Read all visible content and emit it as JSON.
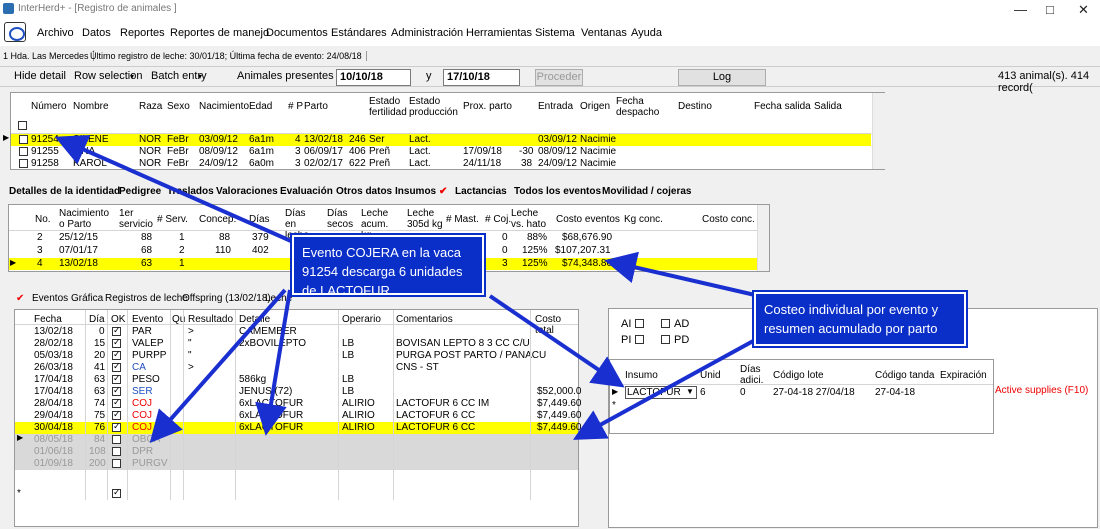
{
  "window": {
    "title": "InterHerd+ - [Registro de animales ]",
    "min": "—",
    "max": "□",
    "close": "✕"
  },
  "menu": [
    "Archivo",
    "Datos",
    "Reportes",
    "Reportes de manejo",
    "Documentos",
    "Estándares",
    "Administración",
    "Herramientas",
    "Sistema",
    "Ventanas",
    "Ayuda"
  ],
  "status": {
    "farm": "1 Hda. Las Mercedes",
    "info": "Último registro de leche: 30/01/18; Última fecha de evento: 24/08/18"
  },
  "toolbar": {
    "hide": "Hide detail",
    "rowsel": "Row selection",
    "batch": "Batch entry",
    "present": "Animales presentes entre",
    "from": "10/10/18",
    "y": "y",
    "to": "17/10/18",
    "proceed": "Proceder",
    "log": "Log",
    "count": "413 animal(s). 414 record("
  },
  "animal_grid": {
    "headers": [
      "Número",
      "Nombre",
      "Raza",
      "Sexo",
      "Nacimiento",
      "Edad",
      "# P",
      "Parto",
      "Estado fertilidad",
      "Estado producción",
      "Prox. parto",
      "Entrada",
      "Origen",
      "Fecha despacho",
      "Destino",
      "Fecha salida",
      "Salida"
    ],
    "rows": [
      {
        "num": "91254",
        "name": "SILENE",
        "raza": "NOR",
        "sexo": "FeBr",
        "nac": "03/09/12",
        "edad": "6a1m",
        "p": "4",
        "parto": "13/02/18",
        "d": "246",
        "fert": "Ser",
        "prod": "Lact.",
        "prox": "",
        "x": "",
        "entrada": "03/09/12",
        "origen": "Nacimie"
      },
      {
        "num": "91255",
        "name": "LINA",
        "raza": "NOR",
        "sexo": "FeBr",
        "nac": "08/09/12",
        "edad": "6a1m",
        "p": "3",
        "parto": "06/09/17",
        "d": "406",
        "fert": "Preñ",
        "prod": "Lact.",
        "prox": "17/09/18",
        "x": "-30",
        "entrada": "08/09/12",
        "origen": "Nacimie"
      },
      {
        "num": "91258",
        "name": "KAROL",
        "raza": "NOR",
        "sexo": "FeBr",
        "nac": "24/09/12",
        "edad": "6a0m",
        "p": "3",
        "parto": "02/02/17",
        "d": "622",
        "fert": "Preñ",
        "prod": "Lact.",
        "prox": "24/11/18",
        "x": "38",
        "entrada": "24/09/12",
        "origen": "Nacimie"
      }
    ]
  },
  "detail_tabs": [
    "Detalles de la identidad",
    "Pedigree",
    "Traslados",
    "Valoraciones",
    "Evaluación",
    "Otros datos",
    "Insumos",
    "Lactancias",
    "Todos los eventos",
    "Movilidad / cojeras"
  ],
  "lact_grid": {
    "headers": [
      "No.",
      "Nacimiento o Parto",
      "1er servicio",
      "# Serv.",
      "Concep.",
      "Días",
      "Días en leche",
      "Días secos",
      "Leche acum. kg",
      "Leche 305d kg",
      "# Mast.",
      "# Coj.",
      "Leche vs. hato",
      "Costo eventos",
      "Kg conc.",
      "Costo conc."
    ],
    "rows": [
      {
        "no": "2",
        "fecha": "25/12/15",
        "s1": "88",
        "serv": "1",
        "conc": "88",
        "dias": "379",
        "coj": "0",
        "vs": "88%",
        "costo": "$68,676.90"
      },
      {
        "no": "3",
        "fecha": "07/01/17",
        "s1": "68",
        "serv": "2",
        "conc": "110",
        "dias": "402",
        "coj": "0",
        "vs": "125%",
        "costo": "$107,207.31"
      },
      {
        "no": "4",
        "fecha": "13/02/18",
        "s1": "63",
        "serv": "1",
        "conc": "",
        "dias": "",
        "coj": "3",
        "vs": "125%",
        "costo": "$74,348.80"
      }
    ]
  },
  "event_tabs": [
    "Eventos",
    "Gráfica",
    "Registros de leche",
    "Offspring (13/02/18)",
    "Leche"
  ],
  "events_grid": {
    "headers": [
      "Fecha",
      "Día",
      "OK",
      "Evento",
      "Qu",
      "Resultado",
      "Detalle",
      "Operario",
      "Comentarios",
      "Costo total"
    ],
    "rows": [
      {
        "f": "13/02/18",
        "d": "0",
        "ev": "PAR",
        "res": ">",
        "det": "CAMEMBER",
        "op": "",
        "com": "",
        "cost": "",
        "cls": ""
      },
      {
        "f": "28/02/18",
        "d": "15",
        "ev": "VALEP",
        "res": "\"",
        "det": "2xBOVILEPTO",
        "op": "LB",
        "com": "BOVISAN LEPTO 8 3 CC C/U",
        "cost": "",
        "cls": ""
      },
      {
        "f": "05/03/18",
        "d": "20",
        "ev": "PURPP",
        "res": "\"",
        "det": "",
        "op": "LB",
        "com": "PURGA POST PARTO / PANACU",
        "cost": "",
        "cls": ""
      },
      {
        "f": "26/03/18",
        "d": "41",
        "ev": "CA",
        "res": ">",
        "det": "",
        "op": "",
        "com": "CNS - ST",
        "cost": "",
        "cls": "blue"
      },
      {
        "f": "17/04/18",
        "d": "63",
        "ev": "PESO",
        "res": "",
        "det": "586kg",
        "op": "LB",
        "com": "",
        "cost": "",
        "cls": ""
      },
      {
        "f": "17/04/18",
        "d": "63",
        "ev": "SER",
        "res": "",
        "det": "JENUS (72)",
        "op": "LB",
        "com": "",
        "cost": "$52,000.0",
        "cls": "blue"
      },
      {
        "f": "28/04/18",
        "d": "74",
        "ev": "COJ",
        "res": "",
        "det": "6xLACTOFUR",
        "op": "ALIRIO",
        "com": "LACTOFUR 6 CC IM",
        "cost": "$7,449.60",
        "cls": "red"
      },
      {
        "f": "29/04/18",
        "d": "75",
        "ev": "COJ",
        "res": "",
        "det": "6xLACTOFUR",
        "op": "ALIRIO",
        "com": "LACTOFUR 6 CC",
        "cost": "$7,449.60",
        "cls": "red"
      },
      {
        "f": "30/04/18",
        "d": "76",
        "ev": "COJ",
        "res": "",
        "det": "6xLACTOFUR",
        "op": "ALIRIO",
        "com": "LACTOFUR 6 CC",
        "cost": "$7,449.60",
        "cls": "red"
      },
      {
        "f": "08/05/18",
        "d": "84",
        "ev": "OBCA",
        "res": "",
        "det": "",
        "op": "",
        "com": "",
        "cost": "",
        "cls": "grey"
      },
      {
        "f": "01/06/18",
        "d": "108",
        "ev": "DPR",
        "res": "",
        "det": "",
        "op": "",
        "com": "",
        "cost": "",
        "cls": "grey"
      },
      {
        "f": "01/09/18",
        "d": "200",
        "ev": "PURGV",
        "res": "",
        "det": "",
        "op": "",
        "com": "",
        "cost": "",
        "cls": "grey"
      }
    ]
  },
  "filters": {
    "ai": "AI",
    "ad": "AD",
    "pi": "PI",
    "pd": "PD"
  },
  "supply_grid": {
    "headers": [
      "Insumo",
      "Unid",
      "Días adici.",
      "Código lote",
      "Código tanda",
      "Expiración"
    ],
    "row": {
      "insumo": "LACTOFUR",
      "unid": "6",
      "dias": "0",
      "lote": "27-04-18 27/04/18",
      "tanda": "27-04-18",
      "exp": ""
    },
    "active": "Active supplies (F10)"
  },
  "callouts": {
    "c1": "Evento COJERA en la vaca 91254 descarga 6 unidades de LACTOFUR",
    "c2": "Costeo individual por evento y resumen acumulado por parto"
  },
  "colors": {
    "highlight": "#ffff00",
    "callout": "#0a2fc9",
    "arrow": "#1a2fd0"
  }
}
